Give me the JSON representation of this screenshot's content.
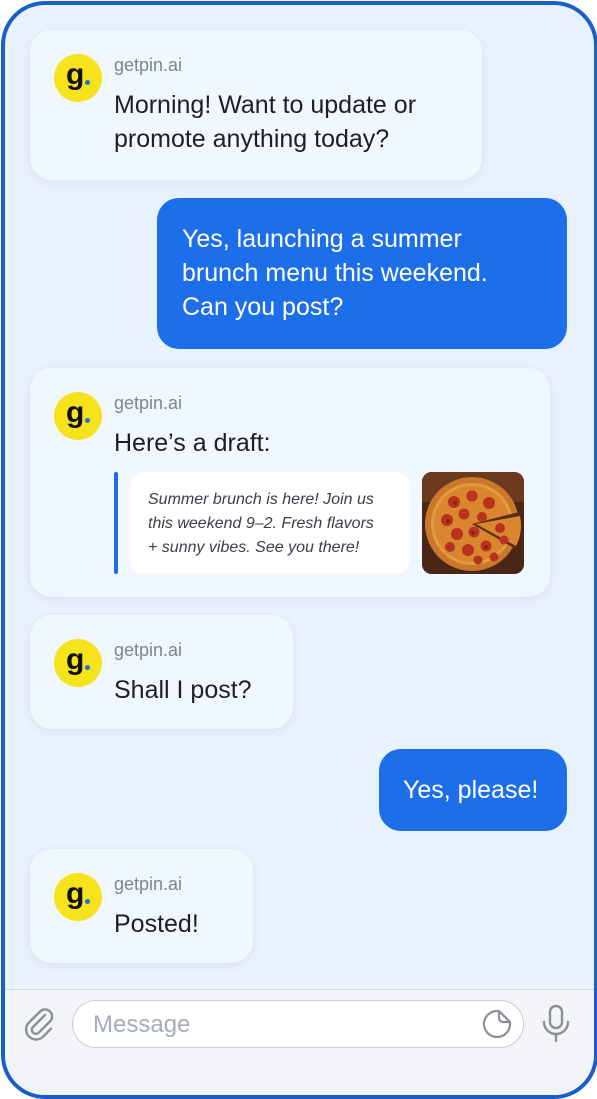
{
  "chat": {
    "messages": [
      {
        "role": "bot",
        "sender": "getpin.ai",
        "lines": [
          "Morning! Want to update or",
          "promote anything today?"
        ]
      },
      {
        "role": "user",
        "lines": [
          "Yes, launching a summer",
          "brunch menu this weekend.",
          "Can you post?"
        ]
      },
      {
        "role": "bot",
        "sender": "getpin.ai",
        "text": "Here’s a draft:",
        "draft": {
          "lines": [
            "Summer brunch is here! Join us",
            "this weekend 9–2. Fresh flavors",
            "+ sunny vibes. See you there!"
          ],
          "image": "pizza-photo"
        }
      },
      {
        "role": "bot",
        "sender": "getpin.ai",
        "text": "Shall I post?"
      },
      {
        "role": "user",
        "text": "Yes, please!"
      },
      {
        "role": "bot",
        "sender": "getpin.ai",
        "text": "Posted!"
      }
    ],
    "avatar_letter": "g"
  },
  "composer": {
    "placeholder": "Message",
    "icons": [
      "paperclip-icon",
      "sticker-icon",
      "microphone-icon"
    ]
  },
  "colors": {
    "frame": "#1a5fc7",
    "background": "#e8f2fd",
    "user_bubble": "#1c6fe8",
    "bot_bubble": "#f1f7fe",
    "avatar": "#f6e31c"
  }
}
